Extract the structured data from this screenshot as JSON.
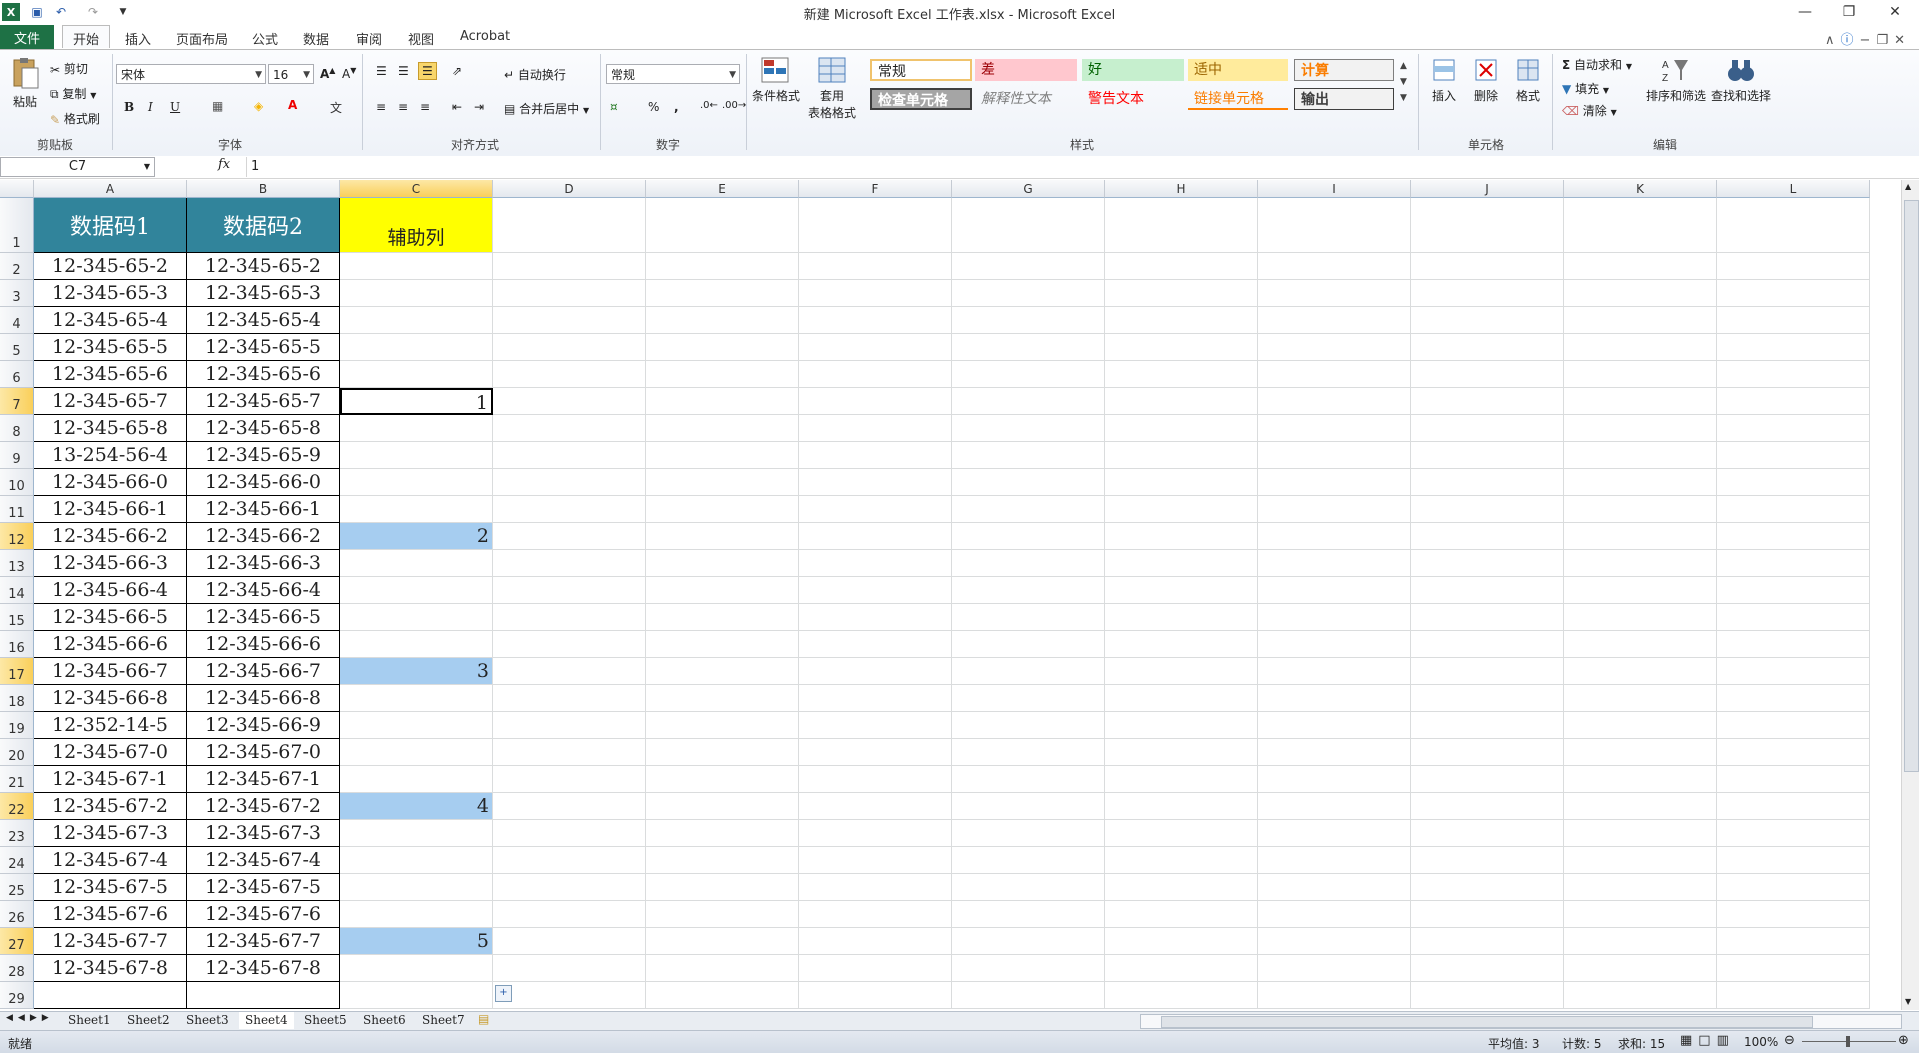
{
  "window": {
    "title": "新建 Microsoft Excel 工作表.xlsx - Microsoft Excel"
  },
  "ribbon_tabs": [
    "文件",
    "开始",
    "插入",
    "页面布局",
    "公式",
    "数据",
    "审阅",
    "视图",
    "Acrobat"
  ],
  "ribbon": {
    "clipboard": {
      "paste": "粘贴",
      "cut": "剪切",
      "copy": "复制",
      "format_painter": "格式刷",
      "label": "剪贴板"
    },
    "font": {
      "name": "宋体",
      "size": "16",
      "bold": "B",
      "italic": "I",
      "underline": "U",
      "label": "字体"
    },
    "alignment": {
      "wrap": "自动换行",
      "merge": "合并后居中",
      "label": "对齐方式"
    },
    "number": {
      "format": "常规",
      "percent": "%",
      "comma": ",",
      "label": "数字"
    },
    "styles": {
      "conditional": "条件格式",
      "table_1": "套用",
      "table_2": "表格格式",
      "cells": [
        "常规",
        "差",
        "好",
        "适中",
        "计算",
        "检查单元格",
        "解释性文本",
        "警告文本",
        "链接单元格",
        "输出"
      ],
      "label": "样式"
    },
    "cells": {
      "insert": "插入",
      "delete": "删除",
      "format": "格式",
      "label": "单元格"
    },
    "editing": {
      "autosum": "自动求和",
      "fill": "填充",
      "clear": "清除",
      "sort": "排序和筛选",
      "find": "查找和选择",
      "label": "编辑"
    }
  },
  "formula_bar": {
    "name_box": "C7",
    "fx": "fx",
    "value": "1"
  },
  "columns": [
    "A",
    "B",
    "C",
    "D",
    "E",
    "F",
    "G",
    "H",
    "I",
    "J",
    "K",
    "L"
  ],
  "header_row": {
    "a": "数据码1",
    "b": "数据码2",
    "c": "辅助列"
  },
  "rows": [
    {
      "n": "1"
    },
    {
      "n": "2",
      "a": "12-345-65-2",
      "b": "12-345-65-2",
      "c": ""
    },
    {
      "n": "3",
      "a": "12-345-65-3",
      "b": "12-345-65-3",
      "c": ""
    },
    {
      "n": "4",
      "a": "12-345-65-4",
      "b": "12-345-65-4",
      "c": ""
    },
    {
      "n": "5",
      "a": "12-345-65-5",
      "b": "12-345-65-5",
      "c": ""
    },
    {
      "n": "6",
      "a": "12-345-65-6",
      "b": "12-345-65-6",
      "c": ""
    },
    {
      "n": "7",
      "a": "12-345-65-7",
      "b": "12-345-65-7",
      "c": "1"
    },
    {
      "n": "8",
      "a": "12-345-65-8",
      "b": "12-345-65-8",
      "c": ""
    },
    {
      "n": "9",
      "a": "13-254-56-4",
      "b": "12-345-65-9",
      "c": ""
    },
    {
      "n": "10",
      "a": "12-345-66-0",
      "b": "12-345-66-0",
      "c": ""
    },
    {
      "n": "11",
      "a": "12-345-66-1",
      "b": "12-345-66-1",
      "c": ""
    },
    {
      "n": "12",
      "a": "12-345-66-2",
      "b": "12-345-66-2",
      "c": "2"
    },
    {
      "n": "13",
      "a": "12-345-66-3",
      "b": "12-345-66-3",
      "c": ""
    },
    {
      "n": "14",
      "a": "12-345-66-4",
      "b": "12-345-66-4",
      "c": ""
    },
    {
      "n": "15",
      "a": "12-345-66-5",
      "b": "12-345-66-5",
      "c": ""
    },
    {
      "n": "16",
      "a": "12-345-66-6",
      "b": "12-345-66-6",
      "c": ""
    },
    {
      "n": "17",
      "a": "12-345-66-7",
      "b": "12-345-66-7",
      "c": "3"
    },
    {
      "n": "18",
      "a": "12-345-66-8",
      "b": "12-345-66-8",
      "c": ""
    },
    {
      "n": "19",
      "a": "12-352-14-5",
      "b": "12-345-66-9",
      "c": ""
    },
    {
      "n": "20",
      "a": "12-345-67-0",
      "b": "12-345-67-0",
      "c": ""
    },
    {
      "n": "21",
      "a": "12-345-67-1",
      "b": "12-345-67-1",
      "c": ""
    },
    {
      "n": "22",
      "a": "12-345-67-2",
      "b": "12-345-67-2",
      "c": "4"
    },
    {
      "n": "23",
      "a": "12-345-67-3",
      "b": "12-345-67-3",
      "c": ""
    },
    {
      "n": "24",
      "a": "12-345-67-4",
      "b": "12-345-67-4",
      "c": ""
    },
    {
      "n": "25",
      "a": "12-345-67-5",
      "b": "12-345-67-5",
      "c": ""
    },
    {
      "n": "26",
      "a": "12-345-67-6",
      "b": "12-345-67-6",
      "c": ""
    },
    {
      "n": "27",
      "a": "12-345-67-7",
      "b": "12-345-67-7",
      "c": "5"
    },
    {
      "n": "28",
      "a": "12-345-67-8",
      "b": "12-345-67-8",
      "c": ""
    },
    {
      "n": "29",
      "a": "",
      "b": "",
      "c": ""
    }
  ],
  "selected_rows": [
    "7",
    "12",
    "17",
    "22",
    "27"
  ],
  "sheets": [
    "Sheet1",
    "Sheet2",
    "Sheet3",
    "Sheet4",
    "Sheet5",
    "Sheet6",
    "Sheet7"
  ],
  "active_sheet": "Sheet4",
  "status": {
    "ready": "就绪",
    "average": "平均值: 3",
    "count": "计数: 5",
    "sum": "求和: 15",
    "zoom": "100%"
  },
  "colors": {
    "header_fill": "#31849b",
    "aux_fill": "#ffff00",
    "selection_fill": "#a6cdf0",
    "file_tab": "#1e7145"
  }
}
